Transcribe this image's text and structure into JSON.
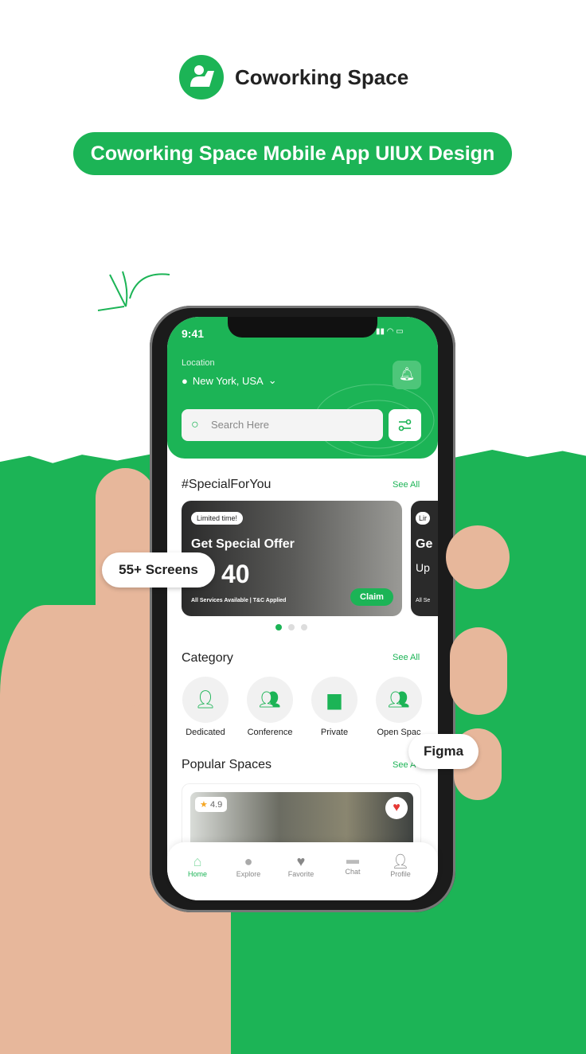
{
  "brand": {
    "name": "Coworking Space",
    "tagline": "Coworking Space Mobile App UIUX Design"
  },
  "badges": {
    "screens": "55+ Screens",
    "tool": "Figma"
  },
  "status": {
    "time": "9:41"
  },
  "header": {
    "location_label": "Location",
    "location": "New York, USA",
    "search_placeholder": "Search Here"
  },
  "special": {
    "title": "#SpecialForYou",
    "see_all": "See All",
    "card": {
      "tag": "Limited time!",
      "title": "Get Special Offer",
      "amount": "40",
      "footer": "All Services Available | T&C Applied",
      "claim": "Claim"
    },
    "card2": {
      "tag": "Lir",
      "title": "Ge",
      "sub": "Up",
      "footer": "All Se"
    }
  },
  "category": {
    "title": "Category",
    "see_all": "See All",
    "items": [
      {
        "label": "Dedicated"
      },
      {
        "label": "Conference"
      },
      {
        "label": "Private"
      },
      {
        "label": "Open Spac"
      }
    ]
  },
  "popular": {
    "title": "Popular Spaces",
    "see_all": "See A",
    "rating": "4.9"
  },
  "nav": {
    "items": [
      {
        "label": "Home"
      },
      {
        "label": "Explore"
      },
      {
        "label": "Favorite"
      },
      {
        "label": "Chat"
      },
      {
        "label": "Profile"
      }
    ],
    "active": "Home"
  },
  "colors": {
    "accent": "#1cb456",
    "background_green": "#1cb456"
  }
}
